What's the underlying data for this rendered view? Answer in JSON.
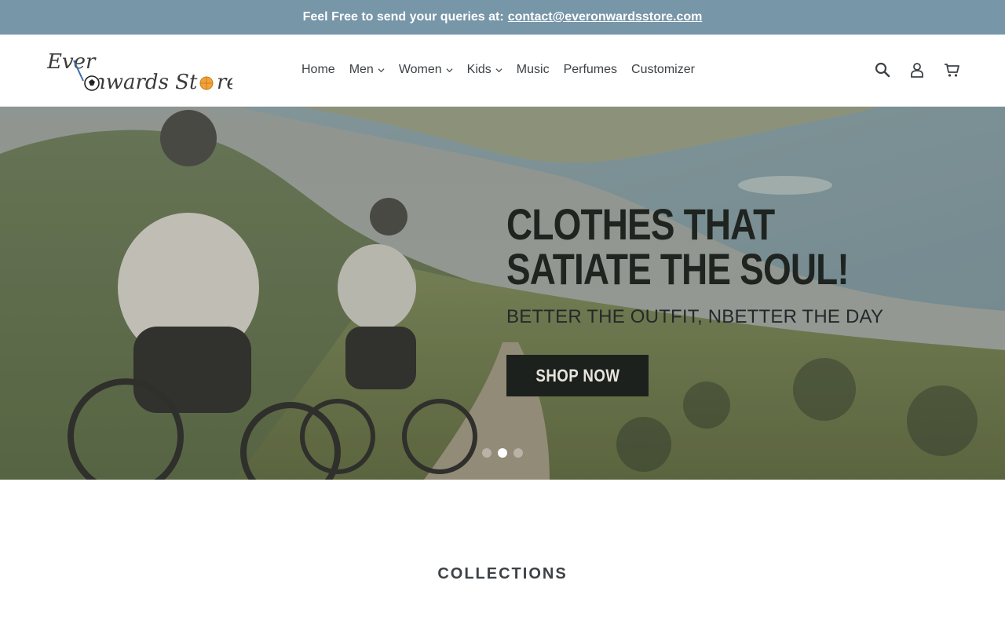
{
  "announcement": {
    "text": "Feel Free to send your queries at:",
    "email": "contact@everonwardsstore.com"
  },
  "logo": {
    "text": "Ever Onwards Store"
  },
  "nav": {
    "items": [
      {
        "label": "Home",
        "dropdown": false
      },
      {
        "label": "Men",
        "dropdown": true
      },
      {
        "label": "Women",
        "dropdown": true
      },
      {
        "label": "Kids",
        "dropdown": true
      },
      {
        "label": "Music",
        "dropdown": false
      },
      {
        "label": "Perfumes",
        "dropdown": false
      },
      {
        "label": "Customizer",
        "dropdown": false
      }
    ]
  },
  "header_icons": [
    "search-icon",
    "user-icon",
    "cart-icon"
  ],
  "hero": {
    "title": "CLOTHES THAT SATIATE THE SOUL!",
    "subtitle": "BETTER THE OUTFIT, NBETTER THE DAY",
    "button_label": "SHOP NOW",
    "slide_count": 3,
    "active_slide": 2
  },
  "sections": {
    "collections_title": "COLLECTIONS"
  },
  "colors": {
    "announcement_bg": "#7796a8",
    "text": "#3d4246",
    "button_bg": "#1d211d"
  }
}
